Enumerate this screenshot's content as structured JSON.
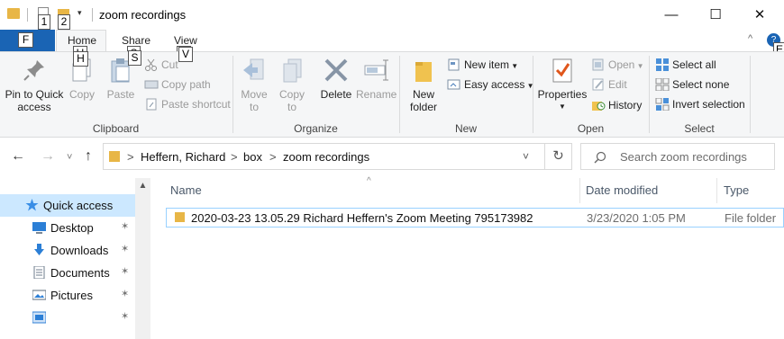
{
  "window": {
    "title": "zoom recordings",
    "minimize_glyph": "—",
    "maximize_glyph": "☐",
    "close_glyph": "✕"
  },
  "qat": {
    "keytip_1": "1",
    "keytip_2": "2",
    "dropdown_glyph": "▾"
  },
  "tabs": {
    "file_keytip": "F",
    "home": "Home",
    "home_keytip": "H",
    "share": "Share",
    "share_keytip": "S",
    "view": "View",
    "view_keytip": "V",
    "help_keytip": "E",
    "help_glyph": "?",
    "collapse_glyph": "^"
  },
  "ribbon": {
    "clipboard": {
      "label": "Clipboard",
      "pin": "Pin to Quick access",
      "copy": "Copy",
      "paste": "Paste",
      "cut": "Cut",
      "copy_path": "Copy path",
      "paste_shortcut": "Paste shortcut"
    },
    "organize": {
      "label": "Organize",
      "move_to": "Move to",
      "copy_to": "Copy to",
      "delete": "Delete",
      "rename": "Rename"
    },
    "new": {
      "label": "New",
      "new_folder": "New folder",
      "new_item": "New item",
      "easy_access": "Easy access"
    },
    "open": {
      "label": "Open",
      "properties": "Properties",
      "open": "Open",
      "edit": "Edit",
      "history": "History"
    },
    "select": {
      "label": "Select",
      "select_all": "Select all",
      "select_none": "Select none",
      "invert": "Invert selection"
    }
  },
  "address": {
    "back_glyph": "←",
    "forward_glyph": "→",
    "recent_glyph": "˅",
    "up_glyph": "↑",
    "crumbs": [
      "Heffern, Richard",
      "box",
      "zoom recordings"
    ],
    "separator": ">",
    "refresh_glyph": "↻",
    "search_placeholder": "Search zoom recordings"
  },
  "navpane": {
    "items": [
      {
        "label": "Quick access",
        "icon": "star-icon"
      },
      {
        "label": "Desktop",
        "icon": "desktop-icon"
      },
      {
        "label": "Downloads",
        "icon": "download-arrow-icon"
      },
      {
        "label": "Documents",
        "icon": "document-icon"
      },
      {
        "label": "Pictures",
        "icon": "pictures-icon"
      },
      {
        "label": "",
        "icon": "screen-icon"
      }
    ],
    "pin_glyph": "✶"
  },
  "filelist": {
    "columns": {
      "name": "Name",
      "date": "Date modified",
      "type": "Type"
    },
    "rows": [
      {
        "name": "2020-03-23 13.05.29 Richard Heffern's Zoom Meeting 795173982",
        "date": "3/23/2020 1:05 PM",
        "type": "File folder"
      }
    ]
  },
  "colors": {
    "accent": "#1a64b4",
    "folder": "#e8b646",
    "selection_border": "#99d1ff",
    "ribbon_bg": "#f5f6f7"
  }
}
